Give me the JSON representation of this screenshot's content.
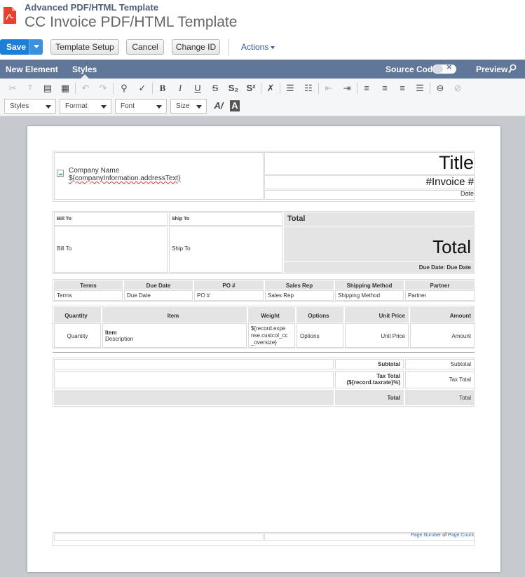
{
  "header": {
    "subtitle": "Advanced PDF/HTML Template",
    "title": "CC Invoice PDF/HTML Template"
  },
  "buttons": {
    "save": "Save",
    "template_setup": "Template Setup",
    "cancel": "Cancel",
    "change_id": "Change ID",
    "actions": "Actions"
  },
  "nav": {
    "new_element": "New Element",
    "styles": "Styles",
    "source_code": "Source Code",
    "preview": "Preview"
  },
  "toolbar": {
    "dropdowns": {
      "styles": "Styles",
      "format": "Format",
      "font": "Font",
      "size": "Size"
    },
    "bold": "B",
    "italic": "I",
    "underline": "U",
    "strike": "S",
    "subscript": "S₂",
    "superscript": "S²"
  },
  "doc": {
    "company_name": "Company Name",
    "company_address": "${companyInformation.addressText}",
    "title": "Title",
    "invoice_no": "#Invoice #",
    "date": "Date",
    "bill_to_header": "Bill To",
    "ship_to_header": "Ship To",
    "total_header": "Total",
    "bill_to": "Bill To",
    "ship_to": "Ship To",
    "total_big": "Total",
    "due_date": "Due Date: Due Date",
    "info_headers": [
      "Terms",
      "Due Date",
      "PO #",
      "Sales Rep",
      "Shipping Method",
      "Partner"
    ],
    "info_values": [
      "Terms",
      "Due Date",
      "PO #",
      "Sales Rep",
      "Shipping Method",
      "Partner"
    ],
    "item_headers": [
      "Quantity",
      "Item",
      "Weight",
      "Options",
      "Unit Price",
      "Amount"
    ],
    "item_row": {
      "quantity": "Quantity",
      "item": "Item",
      "description": "Description",
      "weight_1": "${record.expe",
      "weight_2": "nse.custcol_cc",
      "weight_3": "_oversize}",
      "options": "Options",
      "unit_price": "Unit Price",
      "amount": "Amount"
    },
    "subtotal_label": "Subtotal",
    "subtotal_value": "Subtotal",
    "tax_label_1": "Tax Total",
    "tax_label_2": "(${record.taxrate}%)",
    "tax_value": "Tax Total",
    "total_label": "Total",
    "total_value": "Total",
    "footer_page_number": "Page Number",
    "footer_of": "of",
    "footer_page_count": "Page Count"
  }
}
